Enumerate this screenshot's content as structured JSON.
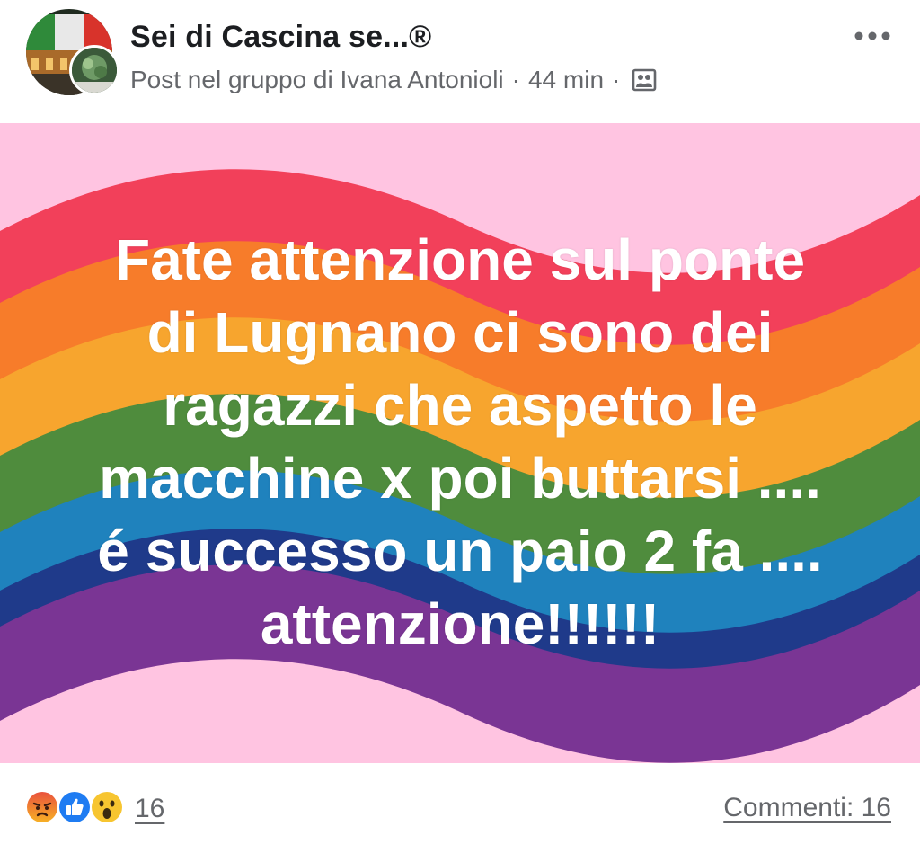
{
  "post": {
    "group_name": "Sei di Cascina se...®",
    "meta_prefix": "Post nel gruppo di",
    "author": "Ivana Antonioli",
    "separator": "·",
    "time": "44 min",
    "privacy_icon": "group-privacy-icon",
    "more_icon": "more-horizontal-icon",
    "text": "Fate attenzione sul ponte\ndi Lugnano ci sono dei\nragazzi che aspetto le\nmacchine x poi buttarsi ....\né successo un paio 2 fa ....\nattenzione!!!!!!",
    "reactions": {
      "icons": [
        "angry-reaction-icon",
        "like-reaction-icon",
        "wow-reaction-icon"
      ],
      "count": "16"
    },
    "comments_label": "Commenti: 16"
  },
  "colors": {
    "background": "#ffc4e1",
    "red": "#f2405a",
    "orange": "#f77c2a",
    "yellow": "#f7a52e",
    "green": "#4f8c3d",
    "blue": "#1f82bd",
    "indigo": "#1f3a8a",
    "violet": "#7a3594",
    "text_secondary": "#65676b"
  }
}
